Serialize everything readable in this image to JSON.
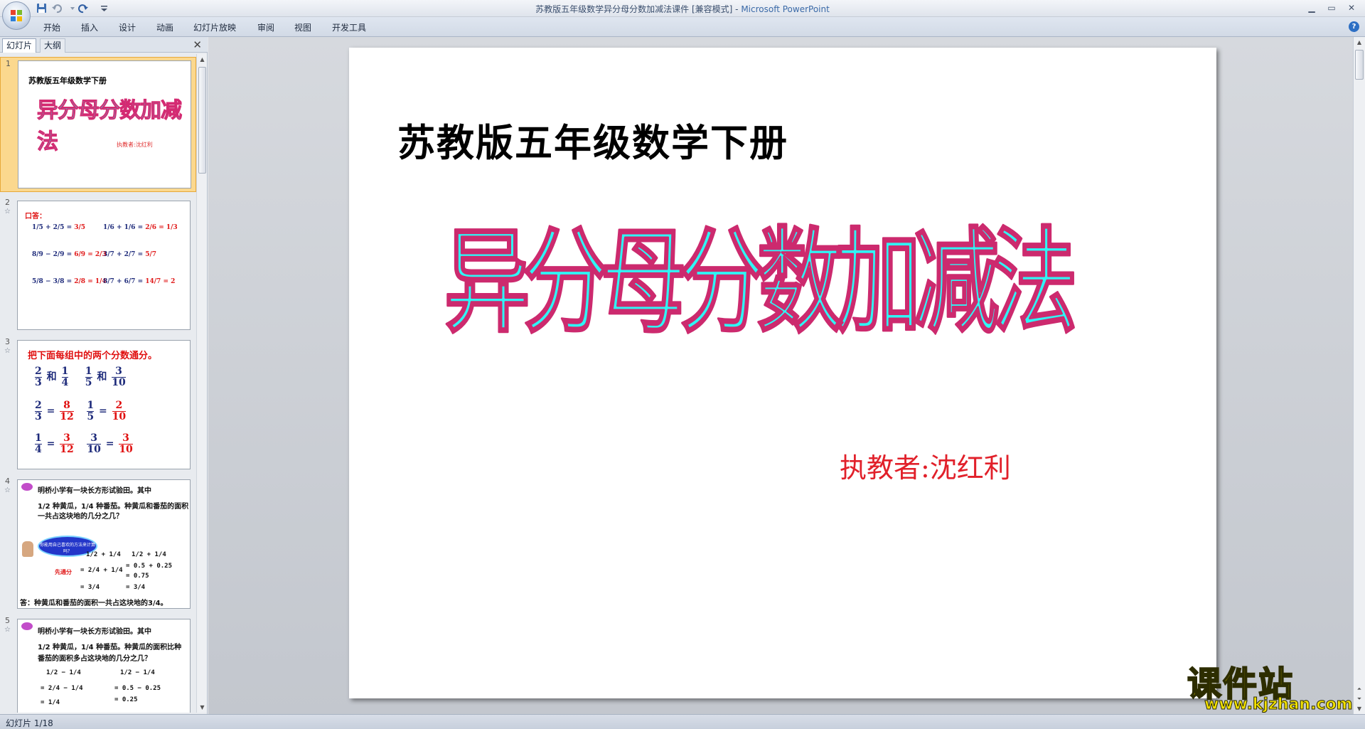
{
  "window": {
    "title": "苏教版五年级数学异分母分数加减法课件 [兼容模式] - ",
    "app_name": "Microsoft PowerPoint"
  },
  "ribbon": {
    "tabs": [
      "开始",
      "插入",
      "设计",
      "动画",
      "幻灯片放映",
      "审阅",
      "视图",
      "开发工具"
    ]
  },
  "left_panel": {
    "tab_slides": "幻灯片",
    "tab_outline": "大纲",
    "slides": [
      {
        "number": "1",
        "subtitle": "苏教版五年级数学下册",
        "title": "异分母分数加减法",
        "author": "执教者:沈红利"
      },
      {
        "number": "2",
        "heading": "口答：",
        "lines": [
          {
            "a": "1/5 + 2/5 = ",
            "b": "3/5",
            "c": "1/6 + 1/6 = ",
            "d": "2/6 = 1/3"
          },
          {
            "a": "8/9 − 2/9 = ",
            "b": "6/9 = 2/3",
            "c": "3/7 + 2/7 = ",
            "d": "5/7"
          },
          {
            "a": "5/8 − 3/8 = ",
            "b": "2/8 = 1/4",
            "c": "8/7 + 6/7 = ",
            "d": "14/7 = 2"
          }
        ]
      },
      {
        "number": "3",
        "heading": "把下面每组中的两个分数通分。",
        "and": "和",
        "eq": "=",
        "row1": {
          "a_num": "2",
          "a_den": "3",
          "b_num": "1",
          "b_den": "4",
          "c_num": "1",
          "c_den": "5",
          "d_num": "3",
          "d_den": "10"
        },
        "row2": {
          "a_num": "2",
          "a_den": "3",
          "b_num": "8",
          "b_den": "12",
          "c_num": "1",
          "c_den": "5",
          "d_num": "2",
          "d_den": "10"
        },
        "row3": {
          "a_num": "1",
          "a_den": "4",
          "b_num": "3",
          "b_den": "12",
          "c_num": "3",
          "c_den": "10",
          "d_num": "3",
          "d_den": "10"
        }
      },
      {
        "number": "4",
        "text1": "明桥小学有一块长方形试验田。其中",
        "text2": "1/2 种黄瓜，1/4 种番茄。种黄瓜和番茄的面积",
        "text3": "一共占这块地的几分之几？",
        "cloud": "你能用自己喜欢的方法来计算吗？",
        "method": "先通分",
        "calc_left": [
          "1/2 + 1/4",
          "= 2/4 + 1/4",
          "= 3/4"
        ],
        "calc_right": [
          "1/2 + 1/4",
          "= 0.5 + 0.25",
          "= 0.75",
          "= 3/4"
        ],
        "answer": "答：种黄瓜和番茄的面积一共占这块地的3/4。"
      },
      {
        "number": "5",
        "text1": "明桥小学有一块长方形试验田。其中",
        "text2": "1/2 种黄瓜，1/4 种番茄。种黄瓜的面积比种",
        "text3": "番茄的面积多占这块地的几分之几？",
        "calc_left": [
          "1/2 − 1/4",
          "= 2/4 − 1/4",
          "= 1/4"
        ],
        "calc_right": [
          "1/2 − 1/4",
          "= 0.5 − 0.25",
          "= 0.25"
        ]
      }
    ]
  },
  "slide": {
    "subtitle": "苏教版五年级数学下册",
    "title": "异分母分数加减法",
    "author": "执教者:沈红利",
    "title_fill": "#2ff5f5",
    "title_outline": "#cc2a6e"
  },
  "status": {
    "text": "幻灯片 1/18"
  },
  "watermark": {
    "big": "课件站",
    "small": "www.kjzhan.com"
  }
}
